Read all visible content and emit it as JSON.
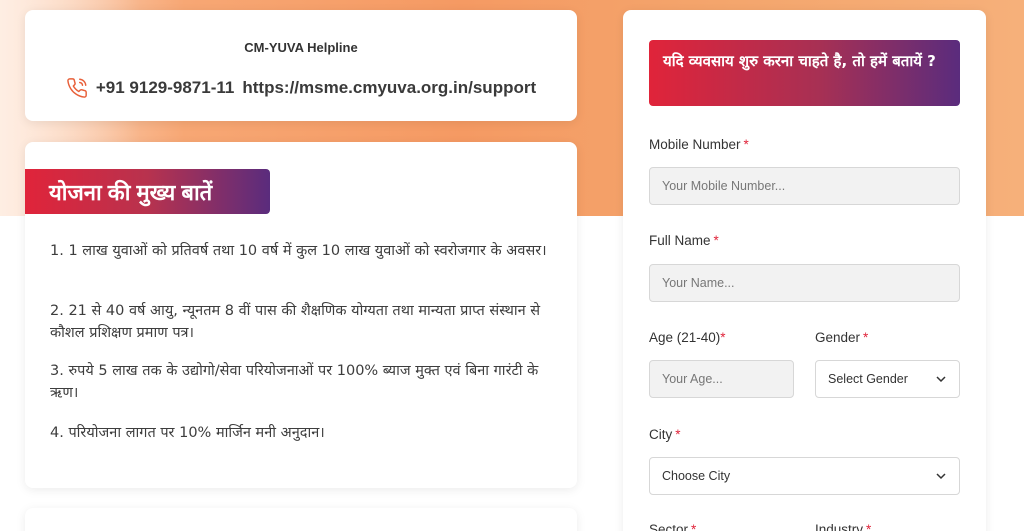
{
  "helpline": {
    "title": "CM-YUVA Helpline",
    "phone": "+91 9129-9871-11",
    "url": "https://msme.cmyuva.org.in/support"
  },
  "features": {
    "heading": "योजना की मुख्य बातें",
    "items": [
      "1. 1 लाख युवाओं को प्रतिवर्ष तथा 10 वर्ष में कुल 10 लाख युवाओं को स्वरोजगार के अवसर।",
      "2. 21 से 40 वर्ष आयु, न्यूनतम 8 वीं पास की शैक्षणिक योग्यता तथा मान्यता प्राप्त संस्थान से कौशल प्रशिक्षण प्रमाण पत्र।",
      "3. रुपये 5 लाख तक के उद्योगो/सेवा परियोजनाओं पर 100% ब्याज मुक्त एवं बिना गारंटी के ऋण।",
      "4. परियोजना लागत पर 10% मार्जिन मनी अनुदान।"
    ]
  },
  "form": {
    "heading": "यदि व्यवसाय शुरु करना चाहते है, तो हमें बतायें ?",
    "required_mark": "*",
    "mobile": {
      "label": "Mobile Number",
      "placeholder": "Your Mobile Number..."
    },
    "name": {
      "label": "Full Name",
      "placeholder": "Your Name..."
    },
    "age": {
      "label": "Age (21-40)",
      "placeholder": "Your Age..."
    },
    "gender": {
      "label": "Gender",
      "value": "Select Gender"
    },
    "city": {
      "label": "City",
      "value": "Choose City"
    },
    "sector": {
      "label": "Sector"
    },
    "industry": {
      "label": "Industry"
    }
  },
  "colors": {
    "accent_red": "#e0243a",
    "accent_purple": "#5a2c7d",
    "hero_orange": "#f59a63"
  }
}
